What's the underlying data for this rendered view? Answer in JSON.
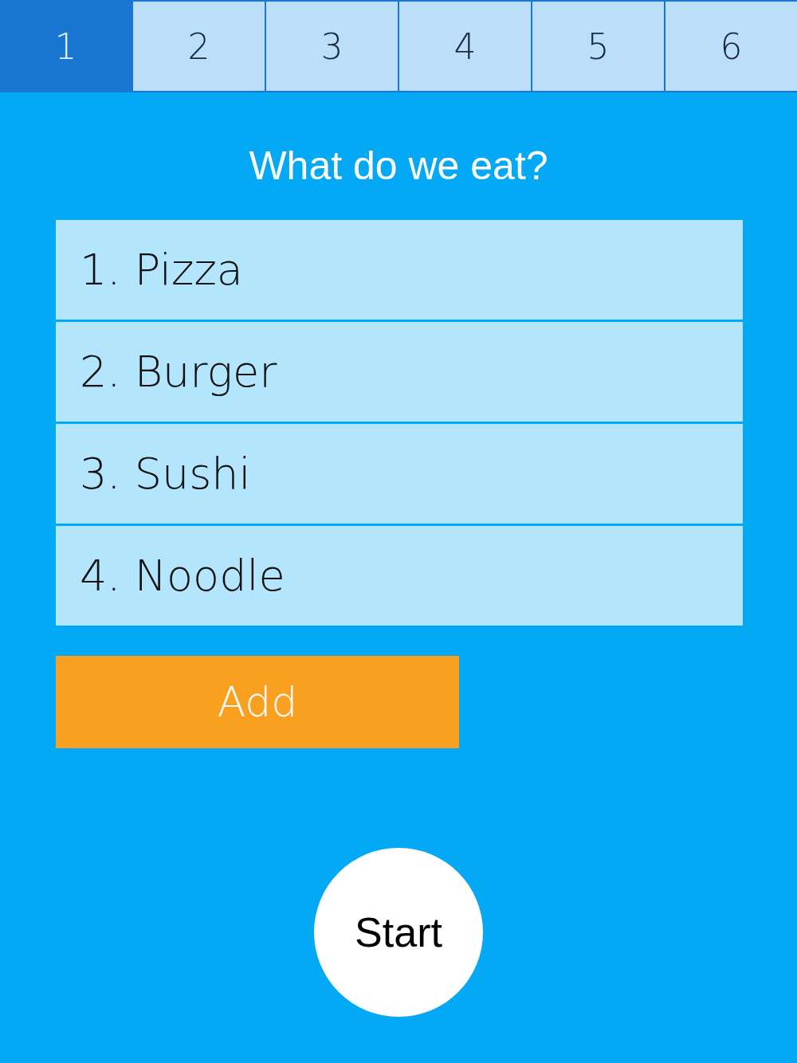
{
  "tabs": [
    {
      "label": "1",
      "selected": true
    },
    {
      "label": "2",
      "selected": false
    },
    {
      "label": "3",
      "selected": false
    },
    {
      "label": "4",
      "selected": false
    },
    {
      "label": "5",
      "selected": false
    },
    {
      "label": "6",
      "selected": false
    }
  ],
  "title": "What do we eat?",
  "items": [
    "1. Pizza",
    "2. Burger",
    "3. Sushi",
    "4. Noodle"
  ],
  "add_button": "Add",
  "start_button": "Start"
}
